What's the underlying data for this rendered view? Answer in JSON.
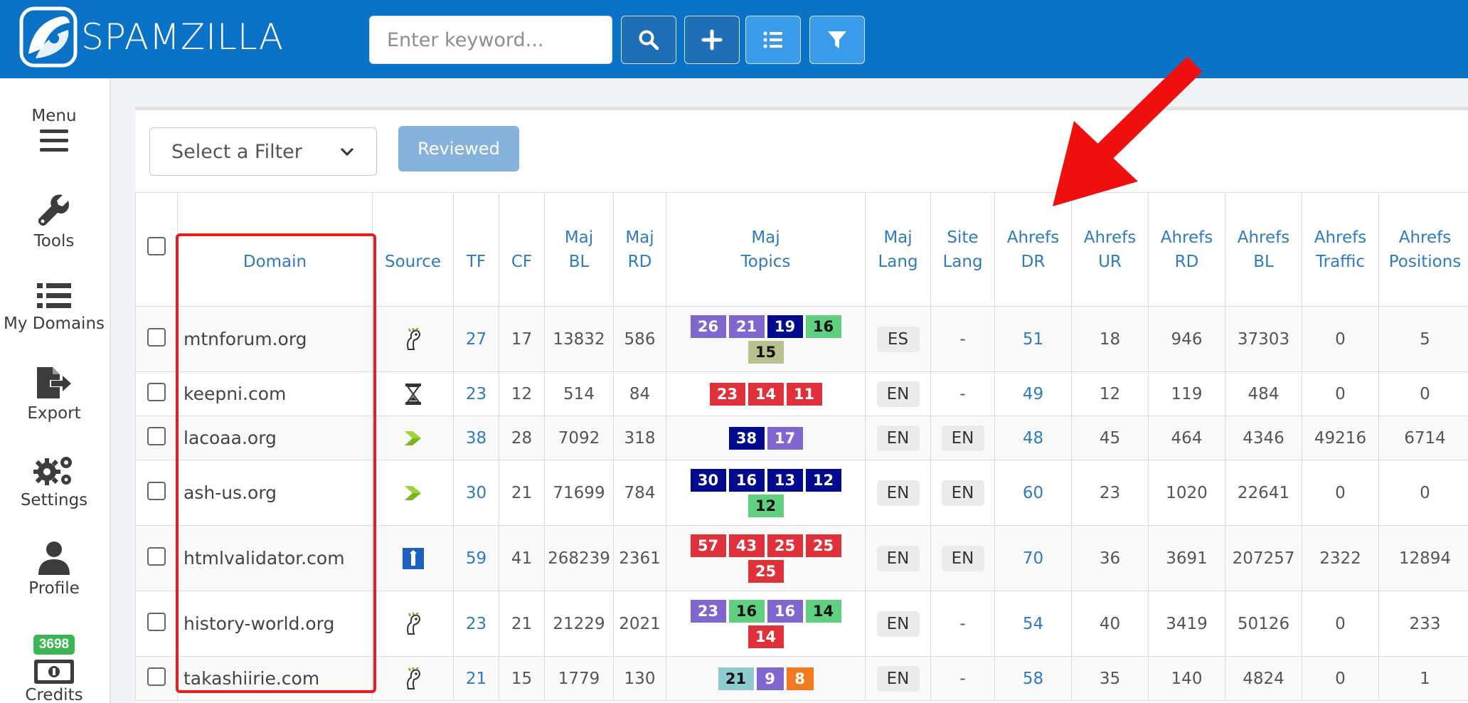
{
  "brand": {
    "name": "SPAMZILLA"
  },
  "search": {
    "placeholder": "Enter keyword..."
  },
  "sidebar": {
    "items": [
      {
        "label": "Menu",
        "icon": "menu-icon"
      },
      {
        "label": "Tools",
        "icon": "wrench-icon"
      },
      {
        "label": "My Domains",
        "icon": "list-icon"
      },
      {
        "label": "Export",
        "icon": "export-icon"
      },
      {
        "label": "Settings",
        "icon": "gear-icon"
      },
      {
        "label": "Profile",
        "icon": "user-icon"
      },
      {
        "label": "Credits",
        "icon": "money-icon",
        "badge": "3698"
      }
    ]
  },
  "toolbar": {
    "filter_label": "Select a Filter",
    "reviewed_label": "Reviewed"
  },
  "table": {
    "headers": [
      {
        "line1": "Domain",
        "line2": ""
      },
      {
        "line1": "Source",
        "line2": ""
      },
      {
        "line1": "TF",
        "line2": ""
      },
      {
        "line1": "CF",
        "line2": ""
      },
      {
        "line1": "Maj",
        "line2": "BL"
      },
      {
        "line1": "Maj",
        "line2": "RD"
      },
      {
        "line1": "Maj",
        "line2": "Topics"
      },
      {
        "line1": "Maj",
        "line2": "Lang"
      },
      {
        "line1": "Site",
        "line2": "Lang"
      },
      {
        "line1": "Ahrefs",
        "line2": "DR"
      },
      {
        "line1": "Ahrefs",
        "line2": "UR"
      },
      {
        "line1": "Ahrefs",
        "line2": "RD"
      },
      {
        "line1": "Ahrefs",
        "line2": "BL"
      },
      {
        "line1": "Ahrefs",
        "line2": "Traffic"
      },
      {
        "line1": "Ahrefs",
        "line2": "Positions"
      }
    ],
    "rows": [
      {
        "domain": "mtnforum.org",
        "source": "godaddy",
        "tf": "27",
        "cf": "17",
        "maj_bl": "13832",
        "maj_rd": "586",
        "topics": [
          {
            "v": "26",
            "c": "#8067cf"
          },
          {
            "v": "21",
            "c": "#8067cf"
          },
          {
            "v": "19",
            "c": "#000a8f"
          },
          {
            "v": "16",
            "c": "#5fcf80",
            "dark": true
          },
          {
            "v": "15",
            "c": "#b9c28f",
            "dark": true
          }
        ],
        "maj_lang": "ES",
        "site_lang": "-",
        "dr": "51",
        "ur": "18",
        "ah_rd": "946",
        "ah_bl": "37303",
        "traffic": "0",
        "positions": "5"
      },
      {
        "domain": "keepni.com",
        "source": "hourglass",
        "tf": "23",
        "cf": "12",
        "maj_bl": "514",
        "maj_rd": "84",
        "topics": [
          {
            "v": "23",
            "c": "#e0313a"
          },
          {
            "v": "14",
            "c": "#e0313a"
          },
          {
            "v": "11",
            "c": "#e0313a"
          }
        ],
        "maj_lang": "EN",
        "site_lang": "-",
        "dr": "49",
        "ur": "12",
        "ah_rd": "119",
        "ah_bl": "484",
        "traffic": "0",
        "positions": "0"
      },
      {
        "domain": "lacoaa.org",
        "source": "arrow",
        "tf": "38",
        "cf": "28",
        "maj_bl": "7092",
        "maj_rd": "318",
        "topics": [
          {
            "v": "38",
            "c": "#000a8f"
          },
          {
            "v": "17",
            "c": "#8067cf"
          }
        ],
        "maj_lang": "EN",
        "site_lang": "EN",
        "dr": "48",
        "ur": "45",
        "ah_rd": "464",
        "ah_bl": "4346",
        "traffic": "49216",
        "positions": "6714"
      },
      {
        "domain": "ash-us.org",
        "source": "arrow",
        "tf": "30",
        "cf": "21",
        "maj_bl": "71699",
        "maj_rd": "784",
        "topics": [
          {
            "v": "30",
            "c": "#000a8f"
          },
          {
            "v": "16",
            "c": "#000a8f"
          },
          {
            "v": "13",
            "c": "#000a8f"
          },
          {
            "v": "12",
            "c": "#000a8f"
          },
          {
            "v": "12",
            "c": "#5fcf80",
            "dark": true
          }
        ],
        "maj_lang": "EN",
        "site_lang": "EN",
        "dr": "60",
        "ur": "23",
        "ah_rd": "1020",
        "ah_bl": "22641",
        "traffic": "0",
        "positions": "0"
      },
      {
        "domain": "htmlvalidator.com",
        "source": "pin",
        "tf": "59",
        "cf": "41",
        "maj_bl": "268239",
        "maj_rd": "2361",
        "topics": [
          {
            "v": "57",
            "c": "#e0313a"
          },
          {
            "v": "43",
            "c": "#e0313a"
          },
          {
            "v": "25",
            "c": "#e0313a"
          },
          {
            "v": "25",
            "c": "#e0313a"
          },
          {
            "v": "25",
            "c": "#e0313a"
          }
        ],
        "maj_lang": "EN",
        "site_lang": "EN",
        "dr": "70",
        "ur": "36",
        "ah_rd": "3691",
        "ah_bl": "207257",
        "traffic": "2322",
        "positions": "12894"
      },
      {
        "domain": "history-world.org",
        "source": "godaddy",
        "tf": "23",
        "cf": "21",
        "maj_bl": "21229",
        "maj_rd": "2021",
        "topics": [
          {
            "v": "23",
            "c": "#8067cf"
          },
          {
            "v": "16",
            "c": "#5fcf80",
            "dark": true
          },
          {
            "v": "16",
            "c": "#8067cf"
          },
          {
            "v": "14",
            "c": "#5fcf80",
            "dark": true
          },
          {
            "v": "14",
            "c": "#e0313a"
          }
        ],
        "maj_lang": "EN",
        "site_lang": "-",
        "dr": "54",
        "ur": "40",
        "ah_rd": "3419",
        "ah_bl": "50126",
        "traffic": "0",
        "positions": "233"
      },
      {
        "domain": "takashiirie.com",
        "source": "godaddy",
        "tf": "21",
        "cf": "15",
        "maj_bl": "1779",
        "maj_rd": "130",
        "topics": [
          {
            "v": "21",
            "c": "#8fcacf",
            "dark": true
          },
          {
            "v": "9",
            "c": "#8067cf",
            "sm": true
          },
          {
            "v": "8",
            "c": "#f47a1f",
            "sm": true
          }
        ],
        "maj_lang": "EN",
        "site_lang": "-",
        "dr": "58",
        "ur": "35",
        "ah_rd": "140",
        "ah_bl": "4824",
        "traffic": "0",
        "positions": "1"
      }
    ]
  },
  "colors": {
    "brand_blue": "#0a73c8",
    "link_blue": "#2f7bc1",
    "highlight_red": "#e61e1e"
  }
}
